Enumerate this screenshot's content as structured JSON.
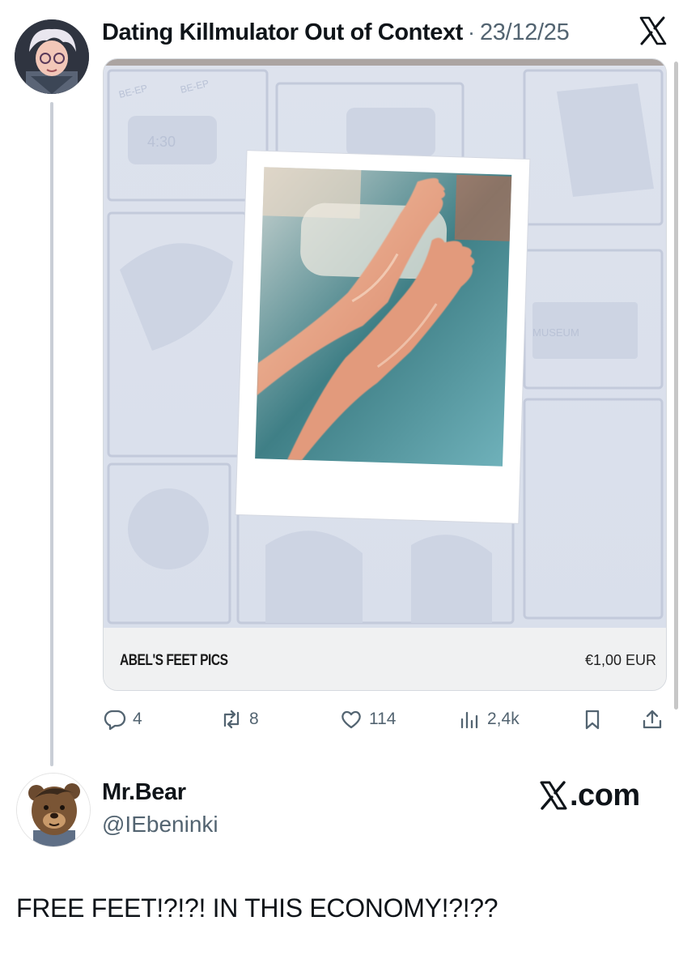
{
  "quoted_tweet": {
    "author_name": "Dating Killmulator Out of Context",
    "separator": "·",
    "date": "23/12/25",
    "platform_icon": "x-logo-icon",
    "card": {
      "title": "ABEL'S FEET PICS",
      "price": "€1,00 EUR",
      "image": "feet-polaroid-illustration",
      "background_panel_text": [
        "BE-EP",
        "BE-EP",
        "4:30",
        "MUSEUM"
      ]
    },
    "actions": {
      "replies": "4",
      "reposts": "8",
      "likes": "114",
      "views": "2,4k"
    }
  },
  "main_tweet": {
    "author_name": "Mr.Bear",
    "handle": "@IEbeninki",
    "brand_glyph": "𝕏",
    "brand_text": ".com",
    "text": "FREE FEET!?!?! IN THIS ECONOMY!?!??"
  },
  "colors": {
    "text_primary": "#0f1419",
    "text_secondary": "#536471",
    "card_panel_bg": "#dfe3ee",
    "thread_line": "#c9ced6"
  }
}
